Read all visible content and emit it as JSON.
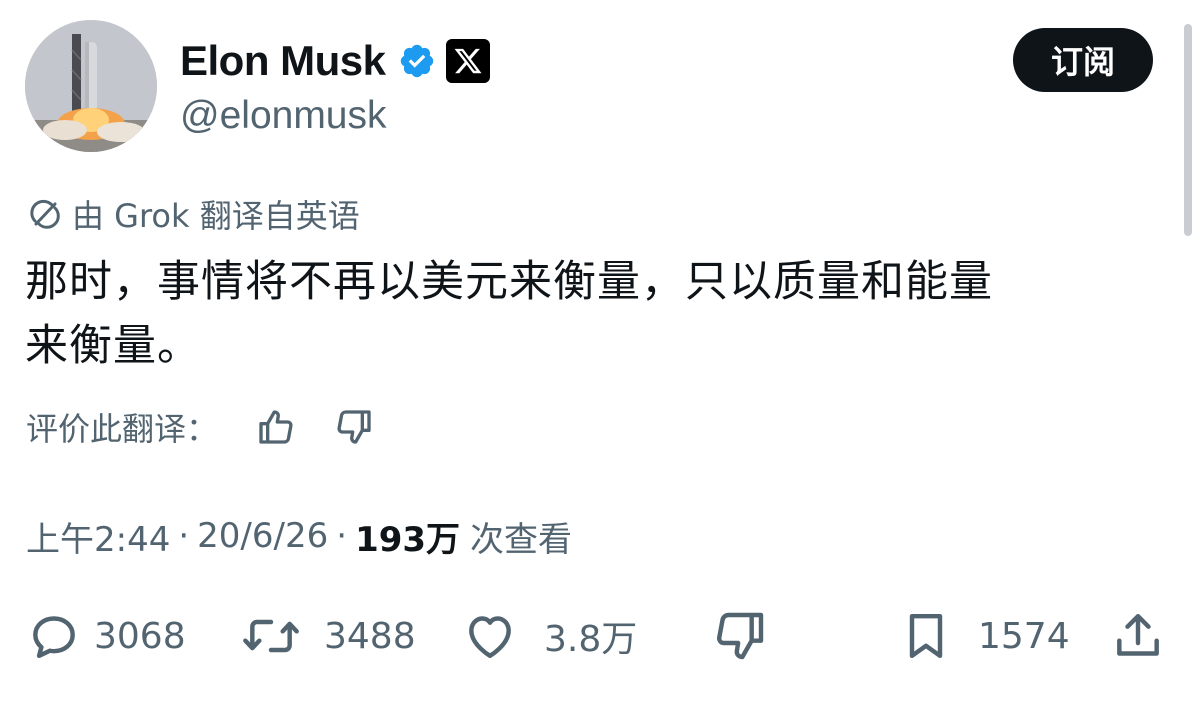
{
  "profile": {
    "display_name": "Elon Musk",
    "handle": "@elonmusk",
    "subscribe_label": "订阅"
  },
  "translation": {
    "label": "由 Grok 翻译自英语",
    "rate_label": "评价此翻译："
  },
  "tweet": {
    "lines": [
      "那时，事情将不再以美元来衡量，只以质量和能量",
      "来衡量。"
    ]
  },
  "meta": {
    "time": "上午2:44",
    "sep1": "·",
    "date": "20/6/26",
    "sep2": "·",
    "views_count": "193万",
    "views_label": "次查看"
  },
  "actions": {
    "replies": "3068",
    "reposts": "3488",
    "likes": "3.8万",
    "bookmarks": "1574"
  },
  "icons": {
    "verified": "verified-badge-icon",
    "x_logo": "x-logo-icon",
    "grok": "grok-icon",
    "thumbs_up": "thumbs-up-icon",
    "thumbs_down": "thumbs-down-icon",
    "reply": "reply-icon",
    "repost": "repost-icon",
    "like": "heart-icon",
    "dislike": "thumbs-down-icon",
    "bookmark": "bookmark-icon",
    "share": "share-icon"
  },
  "colors": {
    "text_primary": "#0f1419",
    "text_secondary": "#536471",
    "verified_blue": "#1d9bf0",
    "button_dark": "#0f1419"
  }
}
